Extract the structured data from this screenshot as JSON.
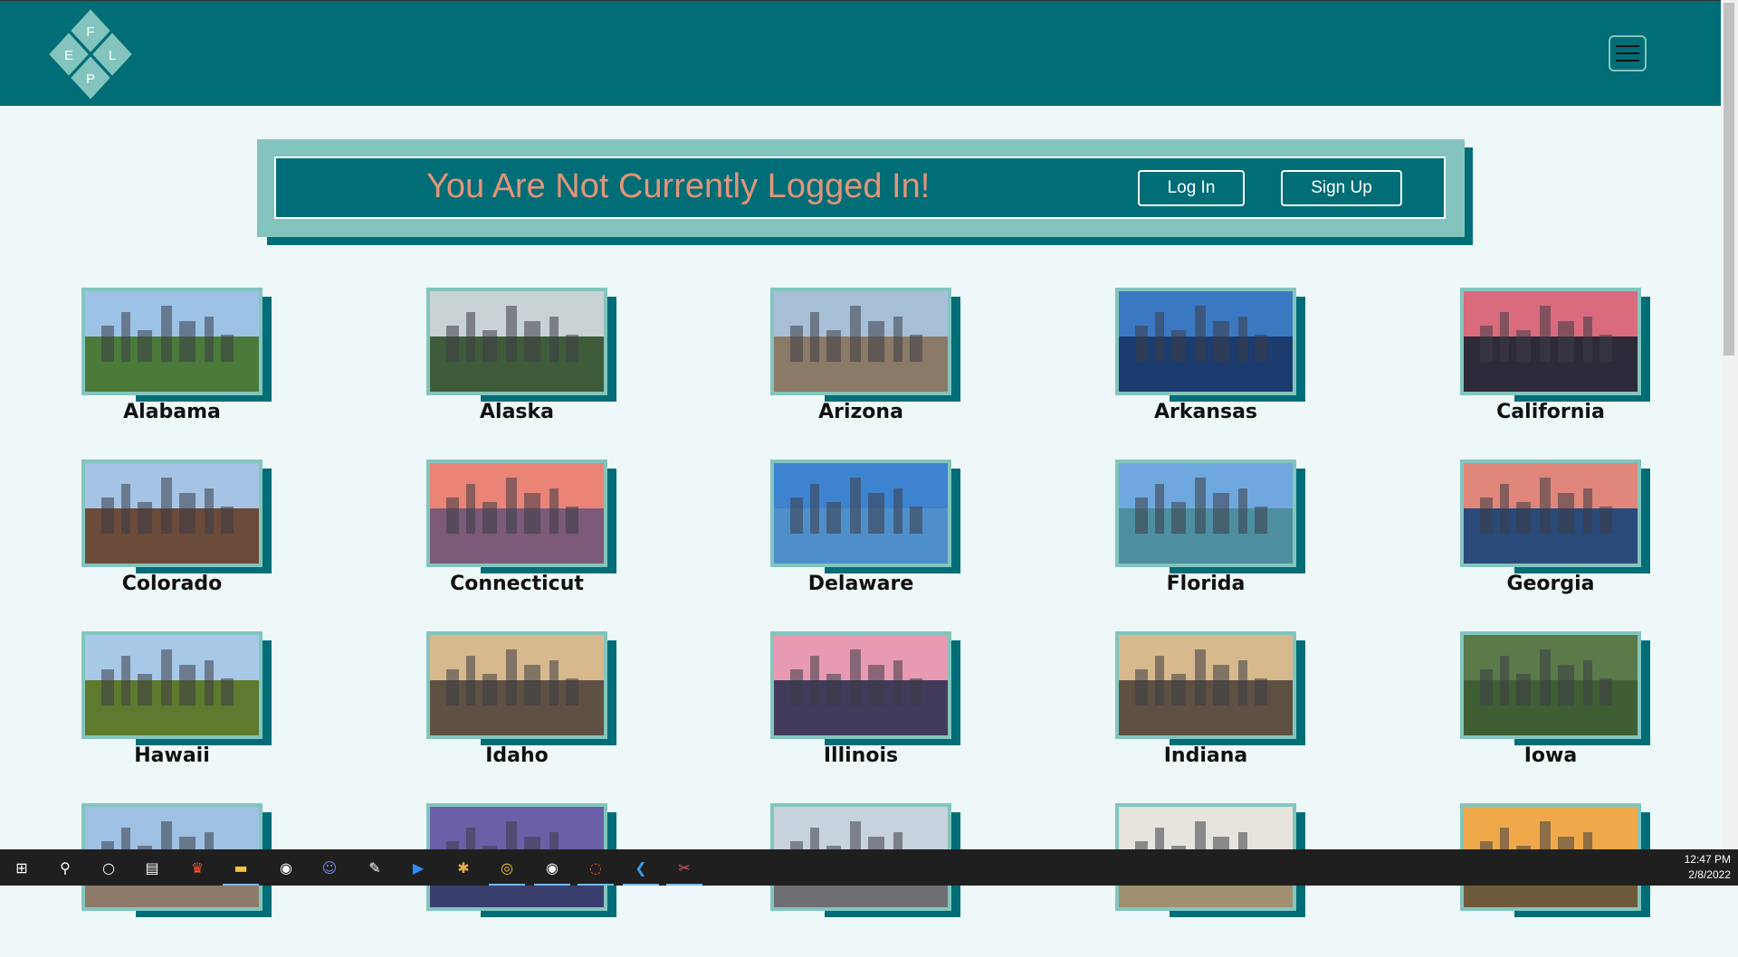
{
  "header": {
    "logo_letters": [
      "F",
      "E",
      "L",
      "P"
    ],
    "menu_icon": "hamburger-icon"
  },
  "banner": {
    "message": "You Are Not Currently Logged In!",
    "login_label": "Log In",
    "signup_label": "Sign Up"
  },
  "states": [
    {
      "name": "Alabama",
      "sky": "#9cc3e6",
      "ground": "#4c7a3a"
    },
    {
      "name": "Alaska",
      "sky": "#c9d3d6",
      "ground": "#3f5c3a"
    },
    {
      "name": "Arizona",
      "sky": "#a7c0d8",
      "ground": "#8a7a66"
    },
    {
      "name": "Arkansas",
      "sky": "#3b78c2",
      "ground": "#1c3b6e"
    },
    {
      "name": "California",
      "sky": "#d96b7d",
      "ground": "#2d2a3a"
    },
    {
      "name": "Colorado",
      "sky": "#a5c3e4",
      "ground": "#6b4b3a"
    },
    {
      "name": "Connecticut",
      "sky": "#e98477",
      "ground": "#7b5a7a"
    },
    {
      "name": "Delaware",
      "sky": "#3e83d0",
      "ground": "#4f8fc9"
    },
    {
      "name": "Florida",
      "sky": "#6fa8de",
      "ground": "#4d8ea0"
    },
    {
      "name": "Georgia",
      "sky": "#e0867a",
      "ground": "#2a4a7a"
    },
    {
      "name": "Hawaii",
      "sky": "#a8c8e8",
      "ground": "#5e7a2e"
    },
    {
      "name": "Idaho",
      "sky": "#d7b98d",
      "ground": "#5e5043"
    },
    {
      "name": "Illinois",
      "sky": "#e79ab2",
      "ground": "#423b5c"
    },
    {
      "name": "Indiana",
      "sky": "#d7b98d",
      "ground": "#5e5043"
    },
    {
      "name": "Iowa",
      "sky": "#5a7a4a",
      "ground": "#3e5e34"
    },
    {
      "name": "",
      "sky": "#9ec0e2",
      "ground": "#8e7a6a"
    },
    {
      "name": "",
      "sky": "#6b5fa8",
      "ground": "#3a3f6e"
    },
    {
      "name": "",
      "sky": "#c8d2dc",
      "ground": "#6e6e72"
    },
    {
      "name": "",
      "sky": "#e7e4de",
      "ground": "#a09070"
    },
    {
      "name": "",
      "sky": "#f0a94a",
      "ground": "#6e5a3a"
    }
  ],
  "taskbar": {
    "time": "12:47 PM",
    "date": "2/8/2022",
    "icons": [
      "windows-start-icon",
      "search-icon",
      "cortana-icon",
      "task-view-icon",
      "brave-browser-icon",
      "file-explorer-icon",
      "steam-icon",
      "discord-icon",
      "game-icon",
      "zoom-icon",
      "slack-icon",
      "chrome-icon",
      "steam-client-icon",
      "ubuntu-icon",
      "vscode-icon",
      "snipping-tool-icon"
    ]
  }
}
